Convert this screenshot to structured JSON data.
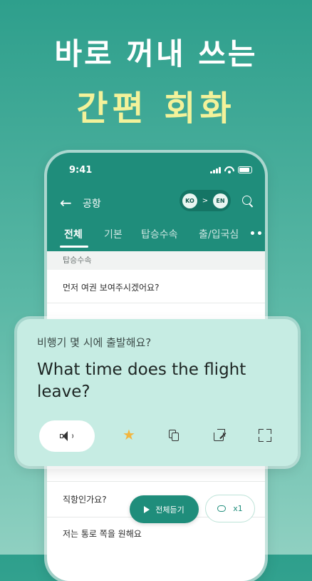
{
  "headline": {
    "line1": "바로 꺼내 쓰는",
    "line2": "간편 회화"
  },
  "status_bar": {
    "time": "9:41"
  },
  "app_bar": {
    "title": "공항",
    "lang_from": "KO",
    "lang_arrow": ">",
    "lang_to": "EN"
  },
  "tabs": [
    "전체",
    "기본",
    "탑승수속",
    "출/입국심"
  ],
  "section_label": "탑승수속",
  "rows": {
    "first": "먼저 여권 보여주시겠어요?",
    "bottom1": "직항인가요?",
    "bottom2": "저는 통로 쪽을 원해요"
  },
  "card": {
    "korean": "비행기 몇 시에 출발해요?",
    "english": "What time does the flight leave?"
  },
  "controls": {
    "play_all_label": "전체듣기",
    "repeat_label": "x1"
  },
  "colors": {
    "accent": "#1f8d7b",
    "headline_highlight": "#f3f29a",
    "card_bg": "#c6ece3",
    "star": "#f2b640"
  },
  "icons": [
    "back-arrow-icon",
    "search-icon",
    "more-icon",
    "speaker-icon",
    "star-icon",
    "copy-icon",
    "share-icon",
    "expand-icon",
    "play-icon",
    "repeat-icon"
  ]
}
